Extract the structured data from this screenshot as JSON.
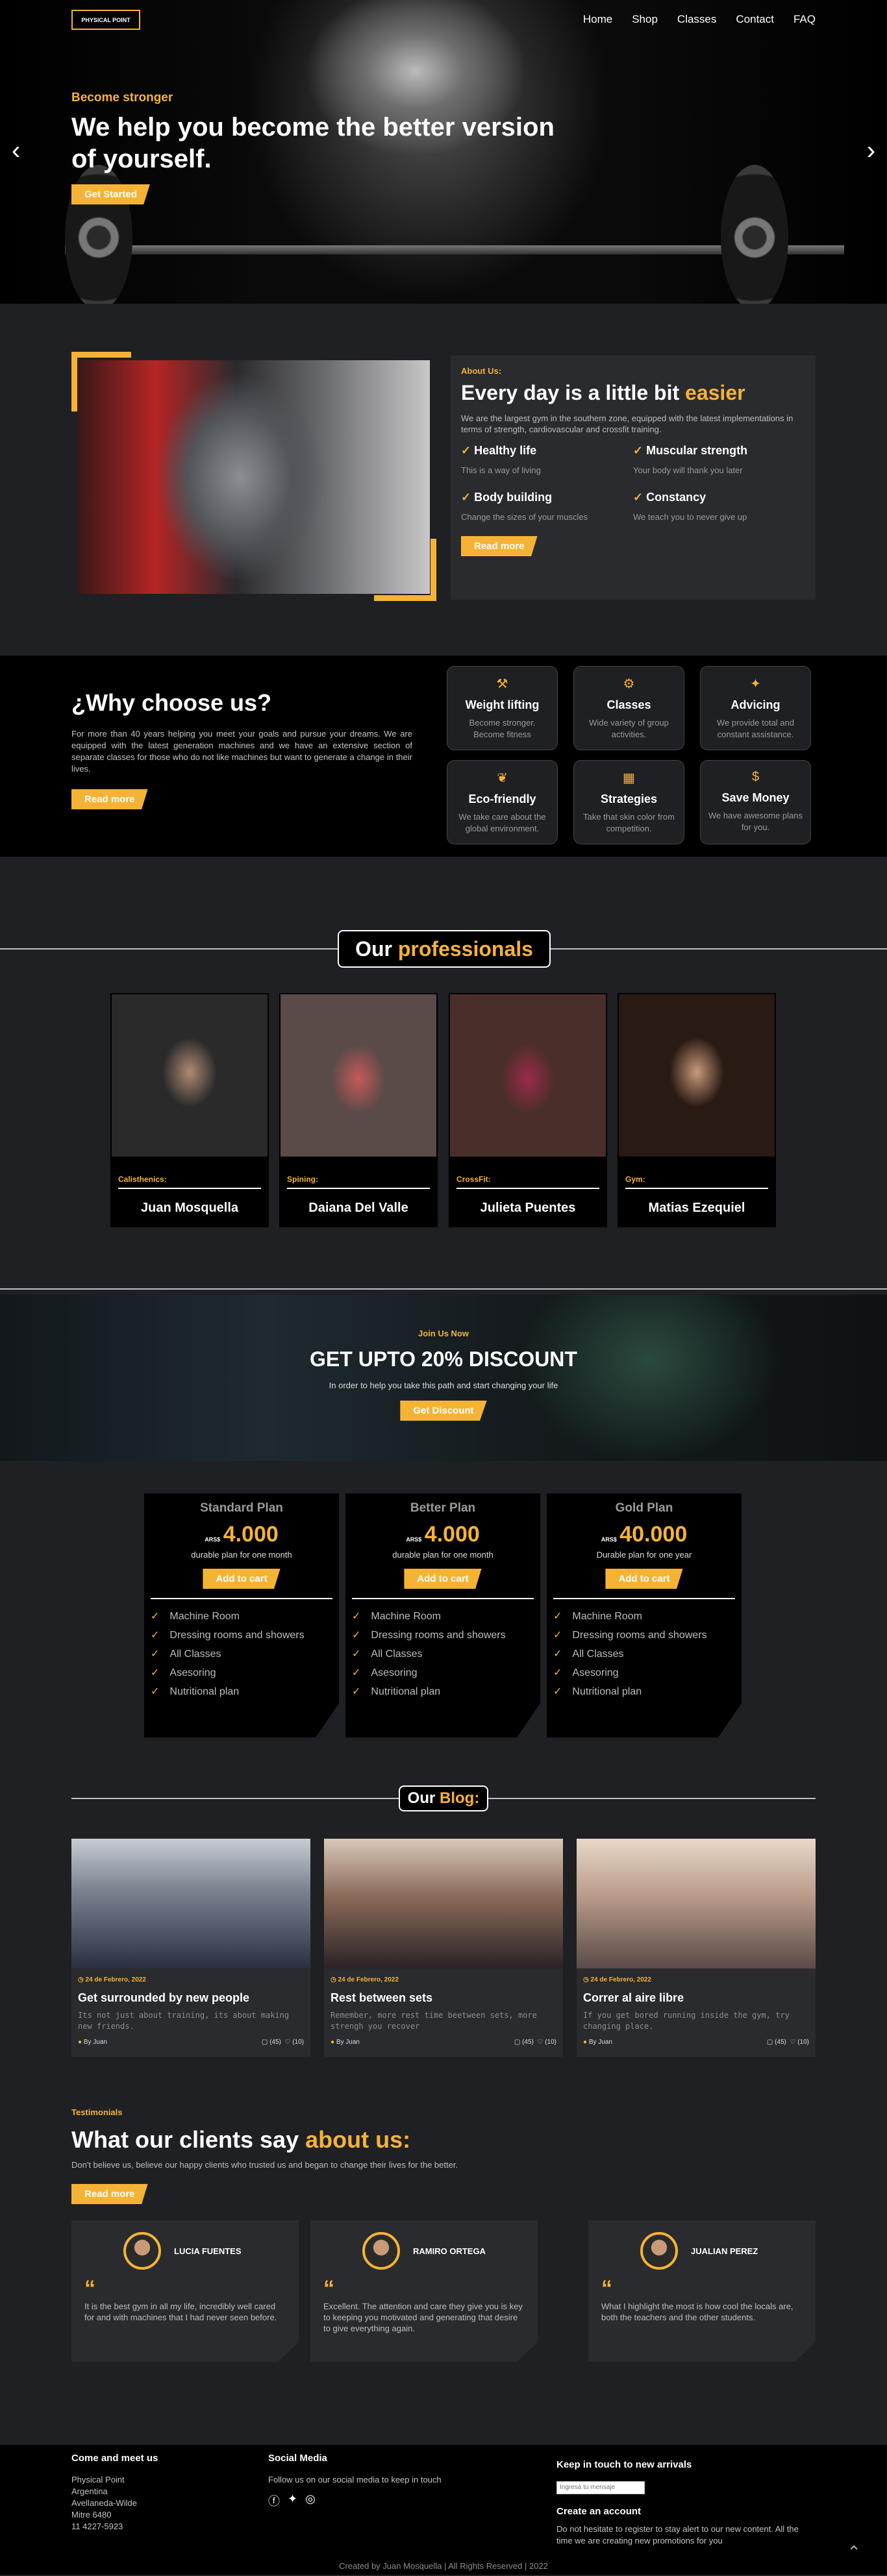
{
  "nav": {
    "logo": "PHYSICAL POINT",
    "items": [
      "Home",
      "Shop",
      "Classes",
      "Contact",
      "FAQ"
    ]
  },
  "hero": {
    "subtitle": "Become stronger",
    "title": "We help you become the better version of yourself.",
    "cta": "Get Started",
    "prev": "‹",
    "next": "›"
  },
  "about": {
    "label": "About Us:",
    "title_main": "Every day is a little bit ",
    "title_accent": "easier",
    "desc": "We are the largest gym in the southern zone, equipped with the latest implementations in terms of strength, cardiovascular and crossfit training.",
    "features": [
      {
        "title": "Healthy life",
        "text": "This is a way of living"
      },
      {
        "title": "Muscular strength",
        "text": "Your body will thank you later"
      },
      {
        "title": "Body building",
        "text": "Change the sizes of your muscles"
      },
      {
        "title": "Constancy",
        "text": "We teach you to never give up"
      }
    ],
    "cta": "Read more"
  },
  "why": {
    "title": "¿Why choose us?",
    "desc": "For more than 40 years helping you meet your goals and pursue your dreams. We are equipped with the latest generation machines and we have an extensive section of separate classes for those who do not like machines but want to generate a change in their lives.",
    "cta": "Read more",
    "cards": [
      {
        "icon": "dumbbell-icon",
        "glyph": "⚒",
        "title": "Weight lifting",
        "text": "Become stronger. Become fitness"
      },
      {
        "icon": "bicycle-icon",
        "glyph": "⚙",
        "title": "Classes",
        "text": "Wide variety of group activities."
      },
      {
        "icon": "running-icon",
        "glyph": "✦",
        "title": "Advicing",
        "text": "We provide total and constant assistance."
      },
      {
        "icon": "leaf-icon",
        "glyph": "❦",
        "title": "Eco-friendly",
        "text": "We take care about the global environment."
      },
      {
        "icon": "strategy-icon",
        "glyph": "▦",
        "title": "Strategies",
        "text": "Take that skin color from competition."
      },
      {
        "icon": "dollar-icon",
        "glyph": "$",
        "title": "Save Money",
        "text": "We have awesome plans for you."
      }
    ]
  },
  "pros": {
    "title_main": "Our ",
    "title_accent": "professionals",
    "people": [
      {
        "role": "Calisthenics:",
        "name": "Juan Mosquella"
      },
      {
        "role": "Spining:",
        "name": "Daiana Del Valle"
      },
      {
        "role": "CrossFit:",
        "name": "Julieta Puentes"
      },
      {
        "role": "Gym:",
        "name": "Matias Ezequiel"
      }
    ]
  },
  "discount": {
    "label": "Join Us Now",
    "title": "GET UPTO 20% DISCOUNT",
    "desc": "In order to help you take this path and start changing your life",
    "cta": "Get Discount"
  },
  "plans": [
    {
      "name": "Standard Plan",
      "currency": "ARS$",
      "price": "4.000",
      "period": "durable plan for one month",
      "cta": "Add to cart",
      "items": [
        "Machine Room",
        "Dressing rooms and showers",
        "All Classes",
        "Asesoring",
        "Nutritional plan"
      ]
    },
    {
      "name": "Better Plan",
      "currency": "ARS$",
      "price": "4.000",
      "period": "durable plan for one month",
      "cta": "Add to cart",
      "items": [
        "Machine Room",
        "Dressing rooms and showers",
        "All Classes",
        "Asesoring",
        "Nutritional plan"
      ]
    },
    {
      "name": "Gold Plan",
      "currency": "ARS$",
      "price": "40.000",
      "period": "Durable plan for one year",
      "cta": "Add to cart",
      "items": [
        "Machine Room",
        "Dressing rooms and showers",
        "All Classes",
        "Asesoring",
        "Nutritional plan"
      ]
    }
  ],
  "blog": {
    "title_main": "Our ",
    "title_accent": "Blog:",
    "posts": [
      {
        "date": "24 de Febrero, 2022",
        "title": "Get surrounded by new people",
        "text": "Its not just about training, its about making new friends.",
        "by": "By Juan",
        "comments": "(45)",
        "likes": "(10)"
      },
      {
        "date": "24 de Febrero, 2022",
        "title": "Rest between sets",
        "text": "Remember, more rest time beetween sets, more strengh you recover",
        "by": "By Juan",
        "comments": "(45)",
        "likes": "(10)"
      },
      {
        "date": "24 de Febrero, 2022",
        "title": "Correr al aire libre",
        "text": "If you get bored running inside the gym, try changing place.",
        "by": "By Juan",
        "comments": "(45)",
        "likes": "(10)"
      }
    ]
  },
  "testi": {
    "label": "Testimonials",
    "title_main": "What our clients say ",
    "title_accent": "about us:",
    "desc": "Don't believe us, believe our happy clients who trusted us and began to change their lives for the better.",
    "cta": "Read more",
    "items": [
      {
        "name": "LUCIA FUENTES",
        "text": "It is the best gym in all my life, incredibly well cared for and with machines that I had never seen before."
      },
      {
        "name": "RAMIRO ORTEGA",
        "text": "Excellent. The attention and care they give you is key to keeping you motivated and generating that desire to give everything again."
      },
      {
        "name": "JUALIAN PEREZ",
        "text": "What I highlight the most is how cool the locals are, both the teachers and the other students."
      }
    ]
  },
  "footer": {
    "meet_title": "Come and meet us",
    "address": [
      "Physical Point",
      "Argentina",
      "Avellaneda-Wilde",
      "Mitre 6480",
      "11 4227-5923"
    ],
    "social_title": "Social Media",
    "social_text": "Follow us on our social media to keep in touch",
    "touch_title": "Keep in touch to new arrivals",
    "email_placeholder": "Ingresá tu mensaje",
    "account_title": "Create an account",
    "account_text": "Do not hesitate to register to stay alert to our new content. All the time we are creating new promotions for you",
    "copyright": "Created by Juan Mosquella | All Rights Reserved | 2022",
    "scroll_top": "⌃"
  }
}
